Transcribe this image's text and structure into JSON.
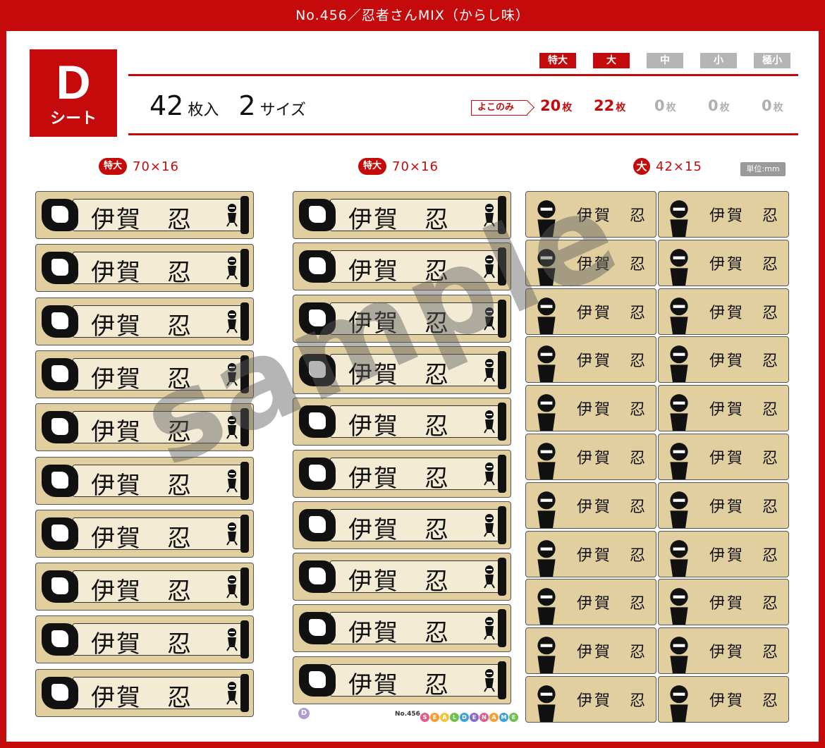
{
  "header": {
    "title": "No.456／忍者さんMIX（からし味）"
  },
  "sheet": {
    "letter": "D",
    "word": "シート"
  },
  "summary": {
    "count": "42",
    "count_unit": "枚入",
    "sizes": "2",
    "sizes_unit": "サイズ"
  },
  "size_tags": [
    {
      "label": "特大",
      "active": true
    },
    {
      "label": "大",
      "active": true
    },
    {
      "label": "中",
      "active": false
    },
    {
      "label": "小",
      "active": false
    },
    {
      "label": "極小",
      "active": false
    }
  ],
  "yoko_label": "よこのみ",
  "quantities": [
    {
      "num": "20",
      "unit": "枚",
      "active": true
    },
    {
      "num": "22",
      "unit": "枚",
      "active": true
    },
    {
      "num": "0",
      "unit": "枚",
      "active": false
    },
    {
      "num": "0",
      "unit": "枚",
      "active": false
    },
    {
      "num": "0",
      "unit": "枚",
      "active": false
    }
  ],
  "columns": [
    {
      "badge": "特大",
      "dims": "70×16"
    },
    {
      "badge": "特大",
      "dims": "70×16"
    },
    {
      "badge": "大",
      "dims": "42×15"
    }
  ],
  "unit_tag": "単位:mm",
  "label_name": "伊賀　忍",
  "watermark": "sample",
  "footer": {
    "sheet_letter": "D",
    "product_no": "No.456",
    "brand": "SEALDENAME"
  },
  "colors": {
    "brand_red": "#c40a0a",
    "label_tan": "#e2cfa0",
    "inactive_gray": "#b5b5b5"
  }
}
